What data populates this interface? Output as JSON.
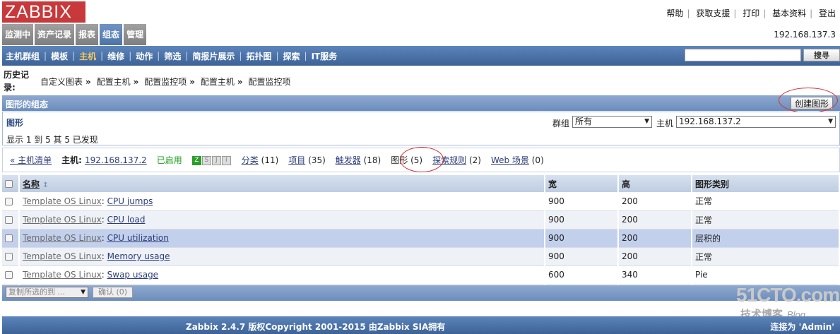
{
  "logo": "ZABBIX",
  "top_links": [
    "帮助",
    "获取支援",
    "打印",
    "基本资料",
    "登出"
  ],
  "main_menu": [
    "监测中",
    "资产记录",
    "报表",
    "组态",
    "管理"
  ],
  "host_ip": "192.168.137.3",
  "sub_menu": [
    "主机群组",
    "模板",
    "主机",
    "维修",
    "动作",
    "筛选",
    "简报片展示",
    "拓扑图",
    "探索",
    "IT服务"
  ],
  "search": {
    "value": "",
    "button": "搜寻"
  },
  "history": {
    "label": "历史记录:",
    "crumbs": [
      "自定义图表",
      "配置主机",
      "配置监控项",
      "配置主机",
      "配置监控项"
    ],
    "sep": "»"
  },
  "config_bar": {
    "title": "图形的组态",
    "create_button": "创建图形"
  },
  "filter": {
    "title": "图形",
    "group_label": "群组",
    "group_value": "所有",
    "host_label": "主机",
    "host_value": "192.168.137.2",
    "found_text": "显示 1 到 5 其 5 已发现"
  },
  "host_nav": {
    "back": "« 主机清单",
    "host_label": "主机:",
    "host_value": "192.168.137.2",
    "status": "已启用",
    "status_icons": [
      "Z",
      "S",
      "J",
      "I"
    ],
    "links": [
      {
        "label": "分类",
        "count": "(11)"
      },
      {
        "label": "项目",
        "count": "(35)"
      },
      {
        "label": "触发器",
        "count": "(18)"
      },
      {
        "label": "图形",
        "count": "(5)"
      },
      {
        "label": "探索规则",
        "count": "(2)"
      },
      {
        "label": "Web 场景",
        "count": "(0)"
      }
    ]
  },
  "table": {
    "headers": [
      "名称",
      "宽",
      "高",
      "图形类别"
    ],
    "rows": [
      {
        "template": "Template OS Linux",
        "name": "CPU jumps",
        "width": "900",
        "height": "200",
        "type": "正常"
      },
      {
        "template": "Template OS Linux",
        "name": "CPU load",
        "width": "900",
        "height": "200",
        "type": "正常"
      },
      {
        "template": "Template OS Linux",
        "name": "CPU utilization",
        "width": "900",
        "height": "200",
        "type": "层积的"
      },
      {
        "template": "Template OS Linux",
        "name": "Memory usage",
        "width": "900",
        "height": "200",
        "type": "正常"
      },
      {
        "template": "Template OS Linux",
        "name": "Swap usage",
        "width": "600",
        "height": "340",
        "type": "Pie"
      }
    ]
  },
  "bulk": {
    "select": "复制所选的到 ...",
    "confirm": "确认 (0)"
  },
  "footer": {
    "copyright": "Zabbix 2.4.7 版权Copyright 2001-2015 由Zabbix SIA拥有",
    "user": "连接为 'Admin'"
  },
  "watermark": {
    "big": "51CTO.com",
    "small": "技术博客",
    "blog": "Blog"
  }
}
